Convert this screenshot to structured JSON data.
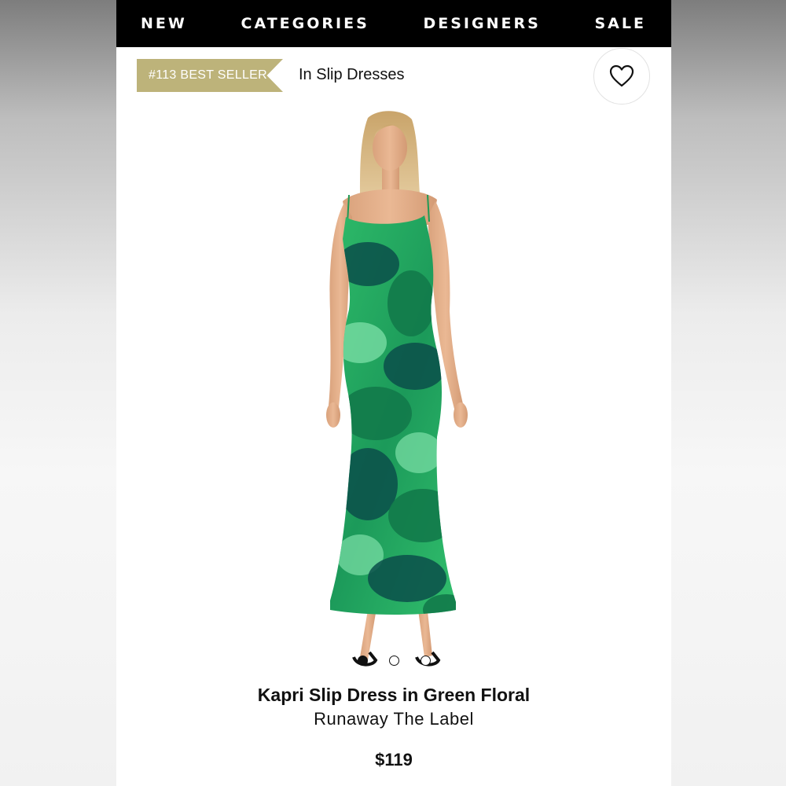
{
  "nav": {
    "items": [
      "NEW",
      "CATEGORIES",
      "DESIGNERS",
      "SALE"
    ]
  },
  "badge": {
    "label": "#113 BEST SELLER",
    "category": "In Slip Dresses",
    "color": "#bdb37a"
  },
  "favorite": {
    "icon": "heart-icon"
  },
  "product": {
    "title": "Kapri Slip Dress in Green Floral",
    "brand": "Runaway The Label",
    "price": "$119",
    "image_icon": "model-in-green-floral-slip-dress",
    "dress_colors": [
      "#2fbd6a",
      "#127a4a",
      "#0b4f4a",
      "#7ee0a8"
    ]
  },
  "carousel": {
    "count": 3,
    "active_index": 0
  }
}
